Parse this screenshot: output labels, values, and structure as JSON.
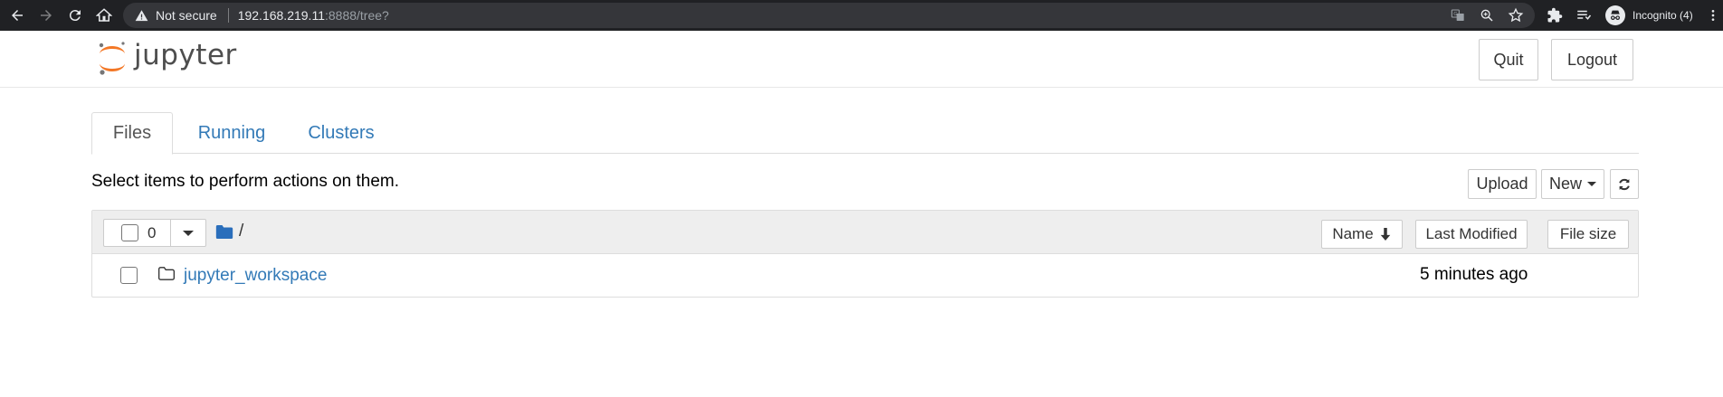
{
  "browser": {
    "security_label": "Not secure",
    "url_host": "192.168.219.11",
    "url_rest": ":8888/tree?",
    "incognito_label": "Incognito (4)",
    "icons": [
      "back-icon",
      "forward-icon",
      "reload-icon",
      "home-icon",
      "warning-icon",
      "translate-icon",
      "zoom-icon",
      "star-icon",
      "extensions-icon",
      "reading-list-icon",
      "incognito-icon",
      "menu-icon"
    ]
  },
  "header": {
    "logo_text": "jupyter",
    "quit_label": "Quit",
    "logout_label": "Logout",
    "logo_orange": "#f37726"
  },
  "tabs": [
    {
      "label": "Files",
      "active": true
    },
    {
      "label": "Running",
      "active": false
    },
    {
      "label": "Clusters",
      "active": false
    }
  ],
  "toolbar": {
    "message": "Select items to perform actions on them.",
    "upload_label": "Upload",
    "new_label": "New",
    "refresh_icon": "refresh-icon"
  },
  "list": {
    "selected_count": "0",
    "breadcrumb": "/",
    "columns": {
      "name": "Name",
      "last_modified": "Last Modified",
      "file_size": "File size"
    },
    "items": [
      {
        "name": "jupyter_workspace",
        "type": "folder",
        "modified": "5 minutes ago"
      }
    ]
  },
  "colors": {
    "link": "#337ab7",
    "chrome_bg": "#202124",
    "folder_blue": "#2a6ebb"
  }
}
